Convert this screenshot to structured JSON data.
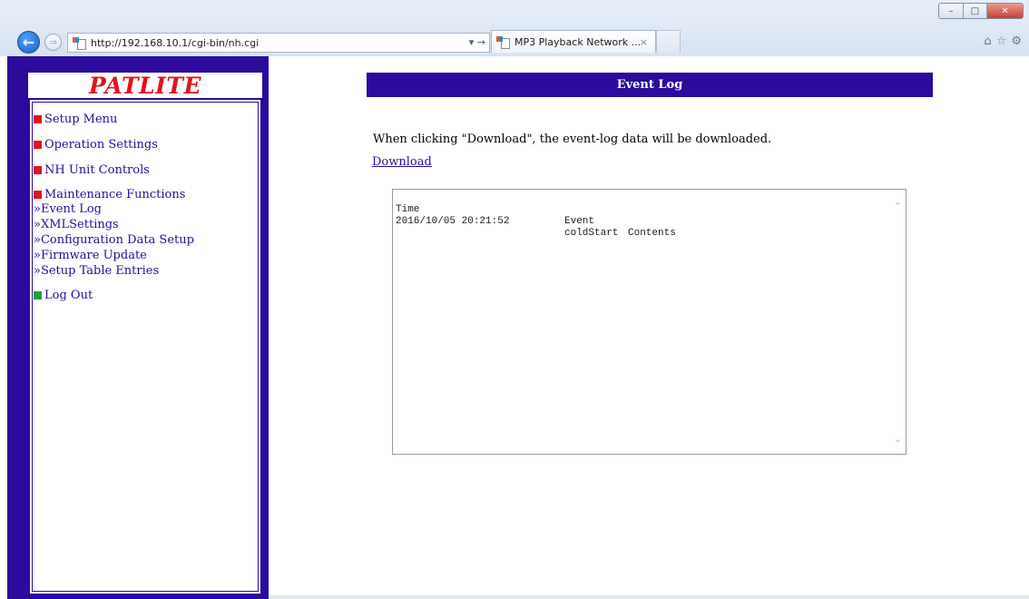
{
  "browser": {
    "url": "http://192.168.10.1/cgi-bin/nh.cgi",
    "tab_title": "MP3 Playback Network ...",
    "tab_close": "×",
    "back_icon": "arrow-left-icon",
    "forward_icon": "arrow-right-icon",
    "go_glyph": "▾ →",
    "window_controls": [
      "–",
      "□",
      "✕"
    ],
    "toolbar_icons": [
      "⌂",
      "☆",
      "⚙"
    ]
  },
  "sidebar": {
    "logo": "PATLITE",
    "menu": [
      {
        "label": "Setup Menu",
        "color": "#e2121b"
      },
      {
        "label": "Operation Settings",
        "color": "#e2121b"
      },
      {
        "label": "NH Unit Controls",
        "color": "#e2121b"
      },
      {
        "label": "Maintenance Functions",
        "color": "#e2121b"
      }
    ],
    "submenu": [
      "»Event Log",
      "»XMLSettings",
      "»Configuration Data Setup",
      "»Firmware Update",
      "»Setup Table Entries"
    ],
    "logout": {
      "label": "Log Out",
      "color": "#1fa040"
    }
  },
  "main": {
    "title": "Event Log",
    "description": "When clicking \"Download\", the event-log data will be downloaded.",
    "download_link": "Download",
    "log": {
      "headers": {
        "time": "Time",
        "event": "Event",
        "contents": "Contents"
      },
      "rows": [
        {
          "time": "2016/10/05 20:21:52",
          "event": "coldStart",
          "contents": ""
        }
      ]
    }
  },
  "colors": {
    "frame": "#2b0a9c",
    "logo": "#e2121b"
  }
}
